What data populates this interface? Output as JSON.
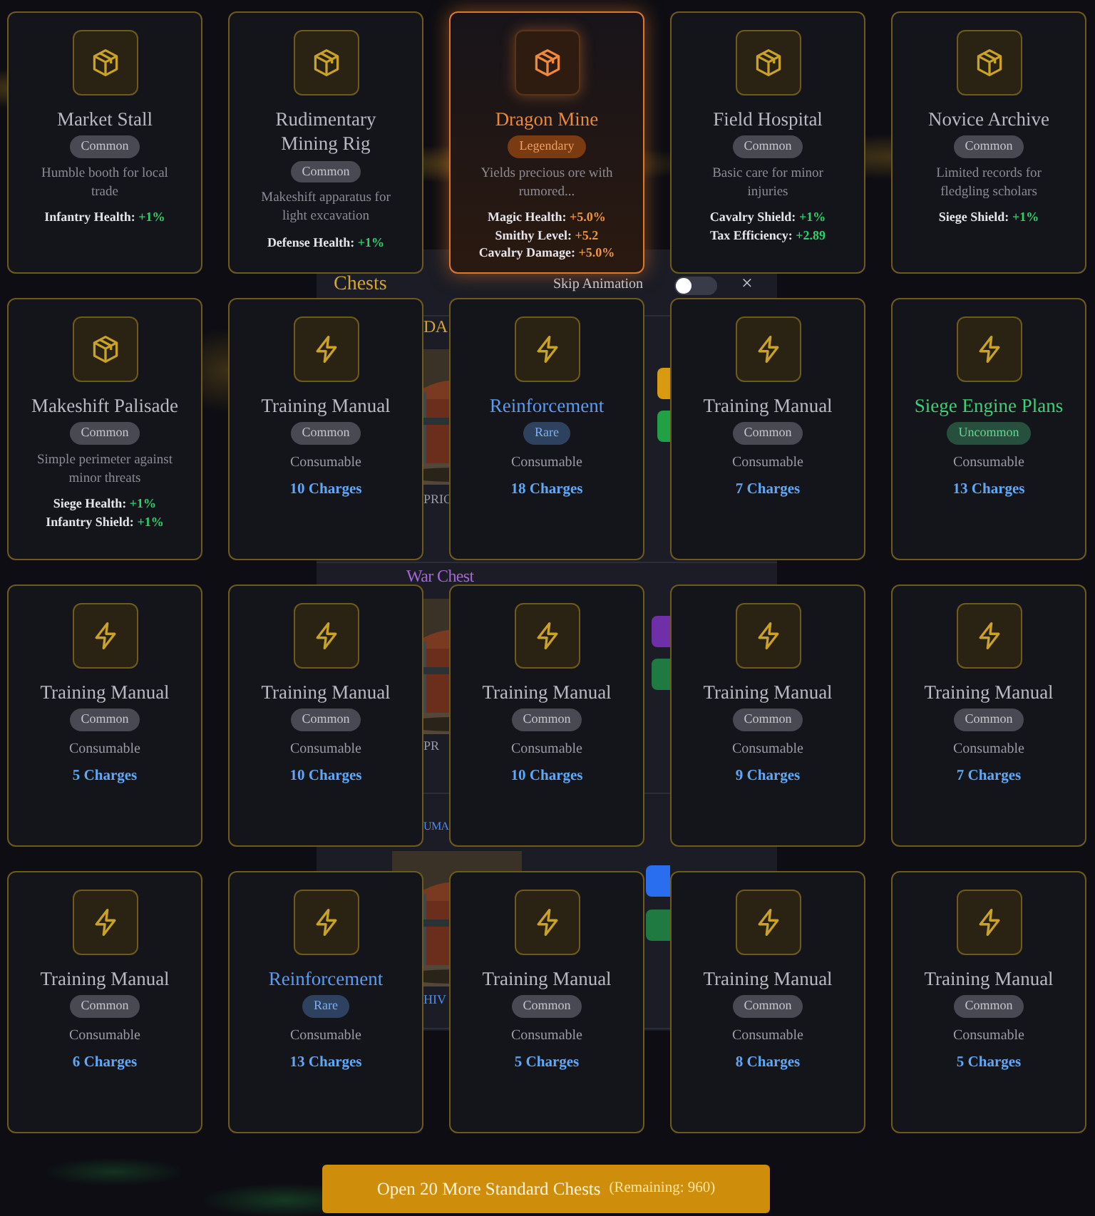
{
  "modal": {
    "title": "Chests",
    "skip_animation": {
      "label": "Skip Animation",
      "on": false
    },
    "close": "×",
    "sections": [
      {
        "title": "DA",
        "color": "#d4a52a",
        "caption": {
          "text": "PRIC",
          "color": "#9a9aa6"
        },
        "buttons": [
          {
            "color": "#d89a10"
          },
          {
            "color": "#22a045"
          }
        ]
      },
      {
        "title": "War Chest",
        "color": "#a566d8",
        "caption": {
          "text": "PR",
          "color": "#9a9aa6"
        },
        "buttons": [
          {
            "color": "#6f2fa8"
          },
          {
            "color": "#1f7a42"
          }
        ]
      },
      {
        "title": "UMA",
        "color": "#4d8fe8",
        "caption": {
          "text": "HIV",
          "color": "#4d8fe8"
        },
        "buttons": [
          {
            "color": "#2a6ef0"
          },
          {
            "color": "#1f7a42"
          }
        ]
      }
    ]
  },
  "cards": [
    {
      "kind": "building",
      "highlighted": false,
      "color": "#b9b9c2",
      "name": "Market Stall",
      "rarity": "Common",
      "description": "Humble booth for local trade",
      "bonuses": [
        {
          "stat": "Infantry Health:",
          "value": "+1%"
        }
      ]
    },
    {
      "kind": "building",
      "highlighted": false,
      "color": "#b9b9c2",
      "name": "Rudimentary Mining Rig",
      "rarity": "Common",
      "description": "Makeshift apparatus for light excavation",
      "bonuses": [
        {
          "stat": "Defense Health:",
          "value": "+1%"
        }
      ]
    },
    {
      "kind": "building",
      "highlighted": true,
      "color": "#e8893a",
      "name": "Dragon Mine",
      "rarity": "Legendary",
      "description": "Yields precious ore with rumored...",
      "bonuses": [
        {
          "stat": "Magic Health:",
          "value": "+5.0%"
        },
        {
          "stat": "Smithy Level:",
          "value": "+5.2"
        },
        {
          "stat": "Cavalry Damage:",
          "value": "+5.0%"
        }
      ]
    },
    {
      "kind": "building",
      "highlighted": false,
      "color": "#b9b9c2",
      "name": "Field Hospital",
      "rarity": "Common",
      "description": "Basic care for minor injuries",
      "bonuses": [
        {
          "stat": "Cavalry Shield:",
          "value": "+1%"
        },
        {
          "stat": "Tax Efficiency:",
          "value": "+2.89"
        }
      ]
    },
    {
      "kind": "building",
      "highlighted": false,
      "color": "#b9b9c2",
      "name": "Novice Archive",
      "rarity": "Common",
      "description": "Limited records for fledgling scholars",
      "bonuses": [
        {
          "stat": "Siege Shield:",
          "value": "+1%"
        }
      ]
    },
    {
      "kind": "building",
      "highlighted": false,
      "color": "#b9b9c2",
      "name": "Makeshift Palisade",
      "rarity": "Common",
      "description": "Simple perimeter against minor threats",
      "bonuses": [
        {
          "stat": "Siege Health:",
          "value": "+1%"
        },
        {
          "stat": "Infantry Shield:",
          "value": "+1%"
        }
      ]
    },
    {
      "kind": "consumable",
      "highlighted": false,
      "color": "#b9b9c2",
      "name": "Training Manual",
      "rarity": "Common",
      "type_label": "Consumable",
      "charges": "10 Charges"
    },
    {
      "kind": "consumable",
      "highlighted": false,
      "color": "#5b9cf0",
      "name": "Reinforcement",
      "rarity": "Rare",
      "type_label": "Consumable",
      "charges": "18 Charges"
    },
    {
      "kind": "consumable",
      "highlighted": false,
      "color": "#b9b9c2",
      "name": "Training Manual",
      "rarity": "Common",
      "type_label": "Consumable",
      "charges": "7 Charges"
    },
    {
      "kind": "consumable",
      "highlighted": false,
      "color": "#3fcf78",
      "name": "Siege Engine Plans",
      "rarity": "Uncommon",
      "type_label": "Consumable",
      "charges": "13 Charges"
    },
    {
      "kind": "consumable",
      "highlighted": false,
      "color": "#b9b9c2",
      "name": "Training Manual",
      "rarity": "Common",
      "type_label": "Consumable",
      "charges": "5 Charges"
    },
    {
      "kind": "consumable",
      "highlighted": false,
      "color": "#b9b9c2",
      "name": "Training Manual",
      "rarity": "Common",
      "type_label": "Consumable",
      "charges": "10 Charges"
    },
    {
      "kind": "consumable",
      "highlighted": false,
      "color": "#b9b9c2",
      "name": "Training Manual",
      "rarity": "Common",
      "type_label": "Consumable",
      "charges": "10 Charges"
    },
    {
      "kind": "consumable",
      "highlighted": false,
      "color": "#b9b9c2",
      "name": "Training Manual",
      "rarity": "Common",
      "type_label": "Consumable",
      "charges": "9 Charges"
    },
    {
      "kind": "consumable",
      "highlighted": false,
      "color": "#b9b9c2",
      "name": "Training Manual",
      "rarity": "Common",
      "type_label": "Consumable",
      "charges": "7 Charges"
    },
    {
      "kind": "consumable",
      "highlighted": false,
      "color": "#b9b9c2",
      "name": "Training Manual",
      "rarity": "Common",
      "type_label": "Consumable",
      "charges": "6 Charges"
    },
    {
      "kind": "consumable",
      "highlighted": false,
      "color": "#5b9cf0",
      "name": "Reinforcement",
      "rarity": "Rare",
      "type_label": "Consumable",
      "charges": "13 Charges"
    },
    {
      "kind": "consumable",
      "highlighted": false,
      "color": "#b9b9c2",
      "name": "Training Manual",
      "rarity": "Common",
      "type_label": "Consumable",
      "charges": "5 Charges"
    },
    {
      "kind": "consumable",
      "highlighted": false,
      "color": "#b9b9c2",
      "name": "Training Manual",
      "rarity": "Common",
      "type_label": "Consumable",
      "charges": "8 Charges"
    },
    {
      "kind": "consumable",
      "highlighted": false,
      "color": "#b9b9c2",
      "name": "Training Manual",
      "rarity": "Common",
      "type_label": "Consumable",
      "charges": "5 Charges"
    }
  ],
  "open_more": {
    "label": "Open 20 More Standard Chests",
    "remaining": "(Remaining: 960)"
  }
}
